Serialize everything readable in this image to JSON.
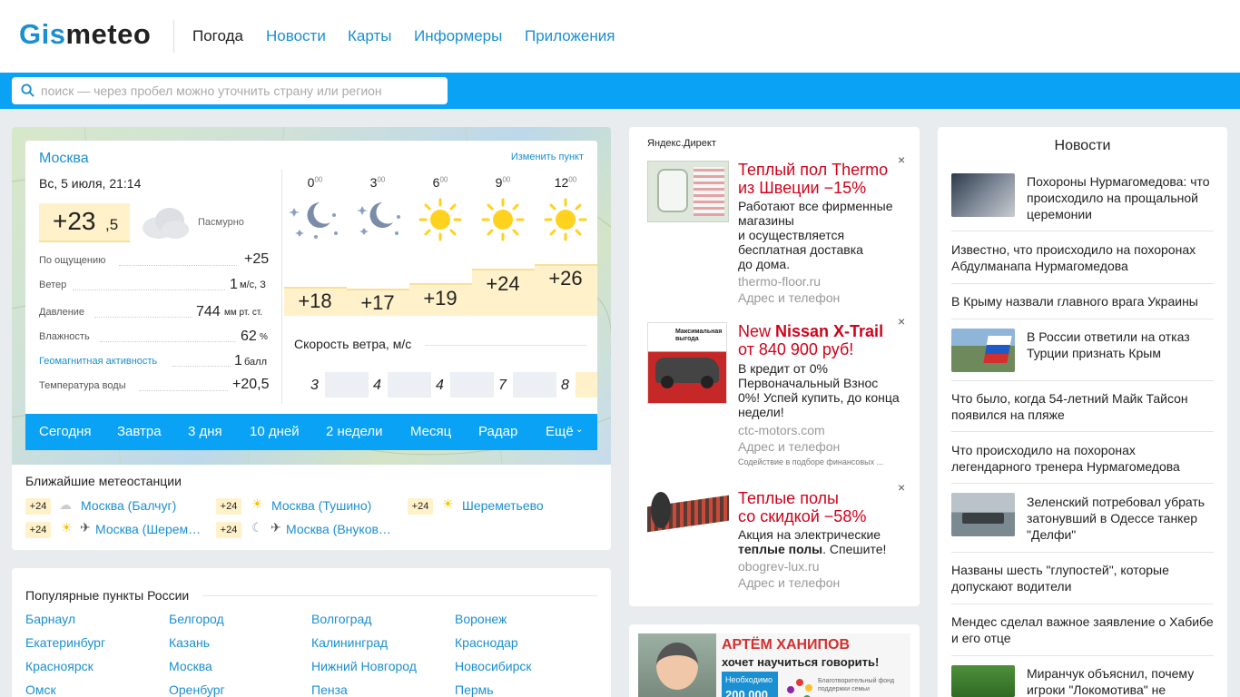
{
  "header": {
    "logo": "Gismeteo",
    "logo_prefix": "Gis",
    "logo_suffix": "meteo",
    "nav": [
      "Погода",
      "Новости",
      "Карты",
      "Информеры",
      "Приложения"
    ]
  },
  "search": {
    "placeholder": "поиск — через пробел можно уточнить страну или регион"
  },
  "weather": {
    "city": "Москва",
    "change_link": "Изменить пункт",
    "date": "Вс, 5 июля, 21:14",
    "temp_main": "+23",
    "temp_decimal": ",5",
    "condition": "Пасмурно",
    "rows": [
      {
        "label": "По ощущению",
        "value": "+25",
        "unit": ""
      },
      {
        "label": "Ветер",
        "value": "1",
        "unit": "м/с, З"
      },
      {
        "label": "Давление",
        "value": "744",
        "unit": "мм рт. ст."
      },
      {
        "label": "Влажность",
        "value": "62",
        "unit": "%"
      },
      {
        "label": "Геомагнитная активность",
        "value": "1",
        "unit": "балл"
      },
      {
        "label": "Температура воды",
        "value": "+20,5",
        "unit": ""
      }
    ],
    "hours": [
      {
        "h": "0",
        "sup": "00",
        "icon": "moon-stars-icon",
        "temp": "+18"
      },
      {
        "h": "3",
        "sup": "00",
        "icon": "moon-stars-icon",
        "temp": "+17"
      },
      {
        "h": "6",
        "sup": "00",
        "icon": "sun-icon",
        "temp": "+19"
      },
      {
        "h": "9",
        "sup": "00",
        "icon": "sun-icon",
        "temp": "+24"
      },
      {
        "h": "12",
        "sup": "00",
        "icon": "sun-icon",
        "temp": "+26"
      }
    ],
    "wind_title": "Скорость ветра, м/с",
    "wind_values": [
      "3",
      "4",
      "4",
      "7",
      "8"
    ],
    "tabs": [
      "Сегодня",
      "Завтра",
      "3 дня",
      "10 дней",
      "2 недели",
      "Месяц",
      "Радар",
      "Ещё"
    ]
  },
  "stations": {
    "title": "Ближайшие метеостанции",
    "items": [
      {
        "temp": "+24",
        "name": "Москва (Балчуг)"
      },
      {
        "temp": "+24",
        "name": "Москва (Тушино)"
      },
      {
        "temp": "+24",
        "name": "Шереметьево"
      },
      {
        "temp": "+24",
        "name": "Москва (Шерем…"
      },
      {
        "temp": "+24",
        "name": "Москва (Внуков…"
      }
    ]
  },
  "popular": {
    "title": "Популярные пункты России",
    "cities": [
      "Барнаул",
      "Белгород",
      "Волгоград",
      "Воронеж",
      "Екатеринбург",
      "Казань",
      "Калининград",
      "Краснодар",
      "Красноярск",
      "Москва",
      "Нижний Новгород",
      "Новосибирск",
      "Омск",
      "Оренбург",
      "Пенза",
      "Пермь"
    ]
  },
  "ads": {
    "label": "Яндекс.Директ",
    "items": [
      {
        "title_lines": [
          "Теплый пол Thermo",
          "из Швеции −15%"
        ],
        "text_lines": [
          "Работают все фирменные",
          "магазины",
          "и осуществляется",
          "бесплатная доставка",
          "до дома."
        ],
        "domain": "thermo-floor.ru",
        "contact": "Адрес и телефон"
      },
      {
        "title_prefix": "New ",
        "title_bold": "Nissan X-Trail",
        "title_line2": "от 840 900 руб!",
        "text_lines": [
          "В кредит от 0%",
          "Первоначальный Взнос",
          "0%! Успей купить, до конца",
          "недели!"
        ],
        "domain": "ctc-motors.com",
        "contact": "Адрес и телефон",
        "note": "Содействие в подборе финансовых ..."
      },
      {
        "title_lines": [
          "Теплые полы",
          "со скидкой −58%"
        ],
        "text_line1": "Акция на электрические",
        "text_bold": "теплые полы",
        "text_after": ". Спешите!",
        "domain": "obogrev-lux.ru",
        "contact": "Адрес и телефон"
      }
    ],
    "banner_title": "АРТЁМ ХАНИПОВ",
    "banner_sub": "хочет научиться говорить!",
    "banner_note": "Необходимо",
    "banner_sum": "200 000",
    "banner_fund": "Благотворительный фонд поддержки семьи"
  },
  "news": {
    "title": "Новости",
    "items": [
      {
        "text": "Похороны Нурмагомедова: что происходило на прощальной церемонии",
        "thumb": true
      },
      {
        "text": "Известно, что происходило на похоронах Абдулманапа Нурмагомедова",
        "thumb": false
      },
      {
        "text": "В Крыму назвали главного врага Украины",
        "thumb": false
      },
      {
        "text": "В России ответили на отказ Турции признать Крым",
        "thumb": true
      },
      {
        "text": "Что было, когда 54-летний Майк Тайсон появился на пляже",
        "thumb": false
      },
      {
        "text": "Что происходило на похоронах легендарного тренера Нурмагомедова",
        "thumb": false
      },
      {
        "text": "Зеленский потребовал убрать затонувший в Одессе танкер \"Делфи\"",
        "thumb": true
      },
      {
        "text": "Названы шесть \"глупостей\", которые допускают водители",
        "thumb": false
      },
      {
        "text": "Мендес сделал важное заявление о Хабибе и его отце",
        "thumb": false
      },
      {
        "text": "Миранчук объяснил, почему игроки \"Локомотива\" не",
        "thumb": true
      }
    ]
  }
}
